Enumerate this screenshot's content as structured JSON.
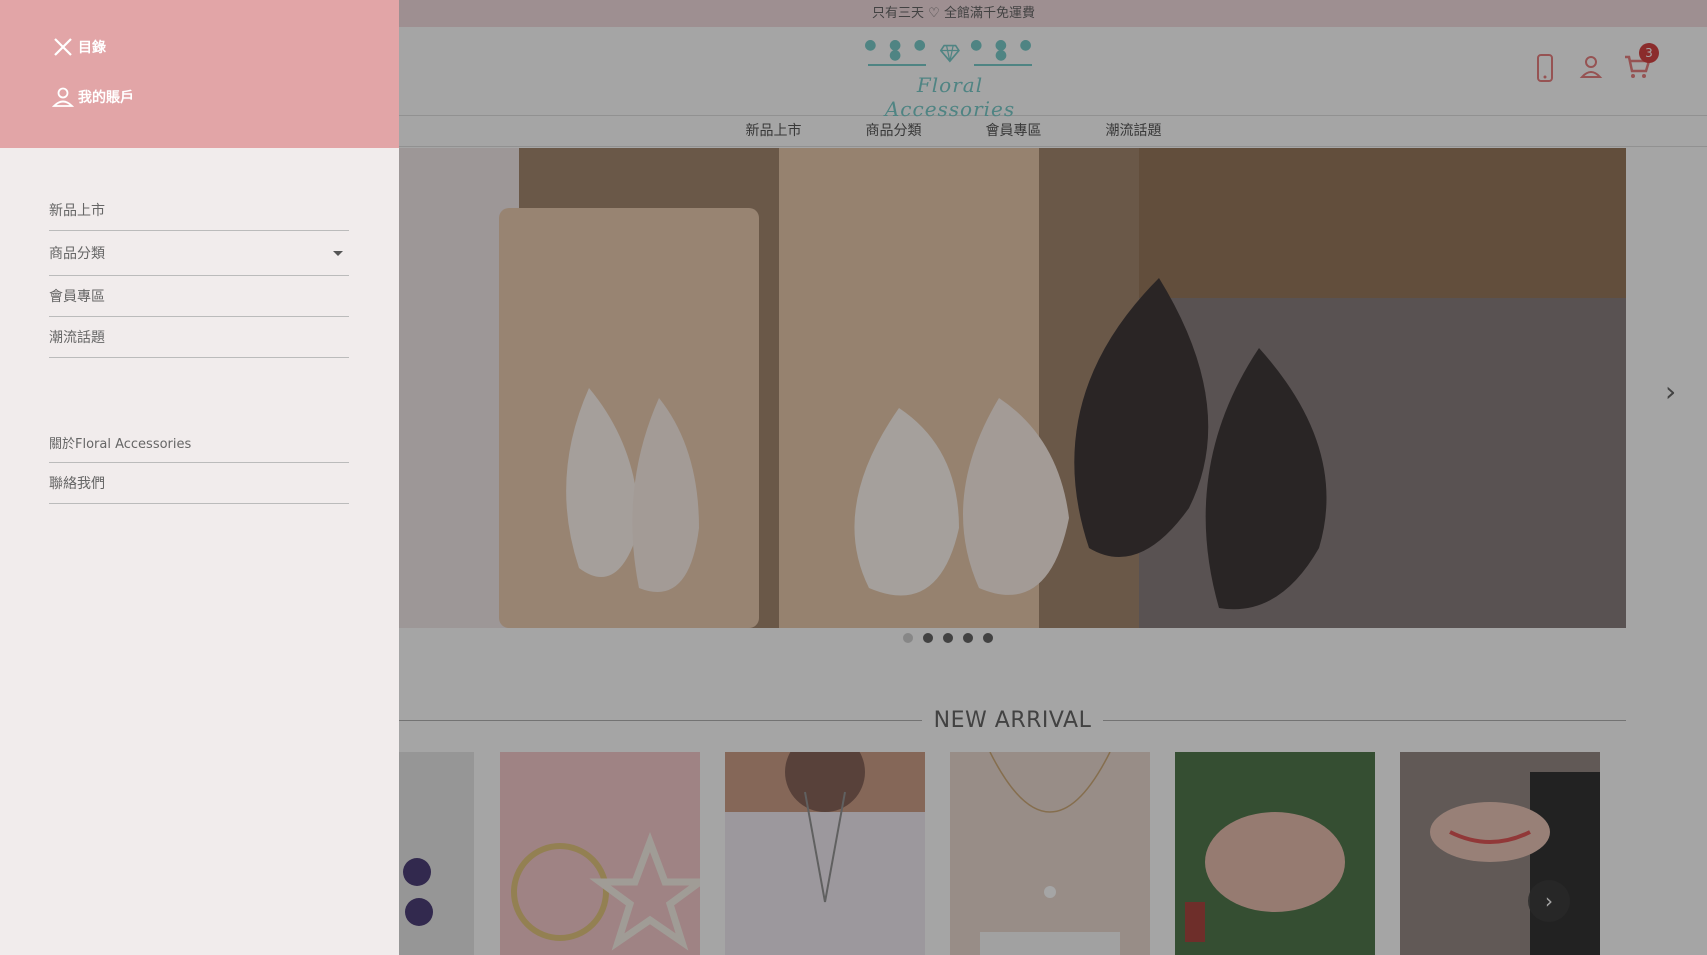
{
  "promo": {
    "text": "只有三天 ♡ 全館滿千免運費"
  },
  "logo": {
    "dots": "● ● ● ●",
    "brand": "Floral Accessories"
  },
  "header": {
    "cart_count": "3"
  },
  "nav": [
    {
      "label": "新品上市"
    },
    {
      "label": "商品分類"
    },
    {
      "label": "會員專區"
    },
    {
      "label": "潮流話題"
    }
  ],
  "section": {
    "new_arrival": "NEW ARRIVAL"
  },
  "drawer": {
    "menu_label": "目錄",
    "account_label": "我的賬戶",
    "items": [
      {
        "label": "新品上市"
      },
      {
        "label": "商品分類"
      },
      {
        "label": "會員專區"
      },
      {
        "label": "潮流話題"
      }
    ],
    "secondary": [
      {
        "label": "關於Floral Accessories"
      },
      {
        "label": "聯絡我們"
      }
    ]
  },
  "colors": {
    "drawer_header": "#e2a5a7",
    "drawer_body": "#f1ecec",
    "logo_teal": "#6cc6c4",
    "cart_badge": "#d32f2f"
  },
  "icons": {
    "close": "close-icon",
    "account": "user-icon",
    "phone": "phone-icon",
    "cart": "cart-icon",
    "next": "chevron-right-icon",
    "dropdown": "caret-down-icon"
  }
}
